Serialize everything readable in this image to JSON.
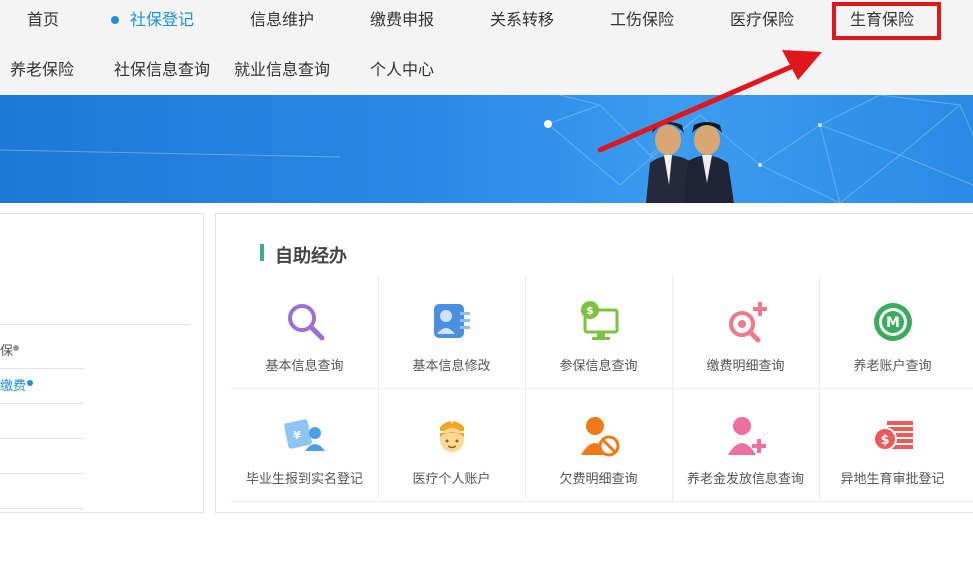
{
  "nav": {
    "row1": [
      "首页",
      "社保登记",
      "信息维护",
      "缴费申报",
      "关系转移",
      "工伤保险",
      "医疗保险",
      "生育保险"
    ],
    "row2": [
      "养老保险",
      "社保信息查询",
      "就业信息查询",
      "个人中心"
    ],
    "active": "社保登记",
    "highlighted": "生育保险"
  },
  "sidebar": {
    "items": [
      {
        "label": "保",
        "dot_color": "#9a9a9a"
      },
      {
        "label": "缴费",
        "dot_color": "#1f8fd8"
      }
    ]
  },
  "main": {
    "section_title": "自助经办",
    "tiles": [
      {
        "label": "基本信息查询",
        "icon": "magnifier-icon",
        "color": "#9b6fd6"
      },
      {
        "label": "基本信息修改",
        "icon": "user-card-icon",
        "color": "#4a8fe0"
      },
      {
        "label": "参保信息查询",
        "icon": "monitor-dollar-icon",
        "color": "#7cc23e"
      },
      {
        "label": "缴费明细查询",
        "icon": "search-plus-icon",
        "color": "#ee7b8a"
      },
      {
        "label": "养老账户查询",
        "icon": "badge-emblem-icon",
        "color": "#3cab5e"
      },
      {
        "label": "毕业生报到实名登记",
        "icon": "id-card-user-icon",
        "color": "#4aa0e6"
      },
      {
        "label": "医疗个人账户",
        "icon": "nurse-icon",
        "color": "#f5a623"
      },
      {
        "label": "欠费明细查询",
        "icon": "user-forbidden-icon",
        "color": "#f07a1a"
      },
      {
        "label": "养老金发放信息查询",
        "icon": "user-add-icon",
        "color": "#ee6fa0"
      },
      {
        "label": "异地生育审批登记",
        "icon": "money-stack-icon",
        "color": "#ee5a5a"
      }
    ]
  }
}
